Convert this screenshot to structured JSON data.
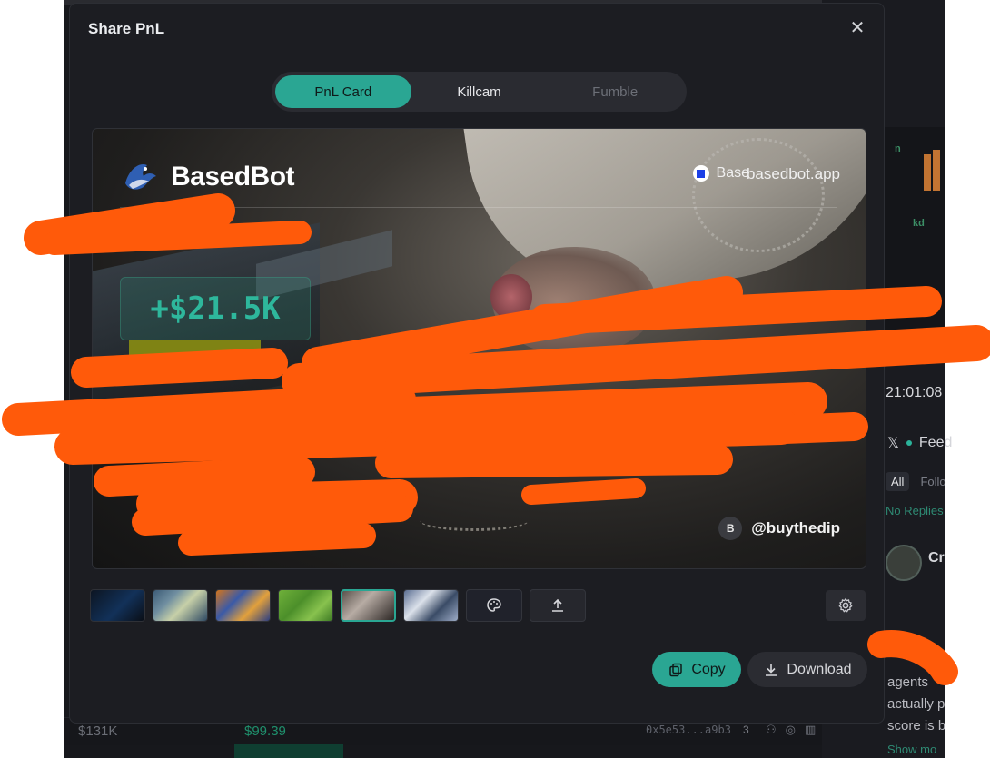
{
  "background": {
    "bottom_row": {
      "price_left": "$131K",
      "price_green": "$99.39",
      "address": "0x5e53...a9b3",
      "count": "3"
    },
    "right_panel": {
      "time": "21:01:08",
      "feed_label": "Feed",
      "tabs": [
        "All",
        "Follo"
      ],
      "no_replies": "No Replies",
      "user_name": "Cr",
      "post_lines": [
        "agents",
        "actually p",
        "score is b"
      ],
      "show_more": "Show mo"
    }
  },
  "modal": {
    "title": "Share PnL",
    "close_icon": "close-icon",
    "tabs": [
      {
        "label": "PnL Card",
        "state": "active"
      },
      {
        "label": "Killcam",
        "state": "normal"
      },
      {
        "label": "Fumble",
        "state": "disabled"
      }
    ],
    "card": {
      "brand": "BasedBot",
      "chain": "Base",
      "site": "basedbot.app",
      "pnl": "+$21.5K",
      "handle_initial": "B",
      "handle": "@buythedip"
    },
    "backgrounds": [
      "space",
      "city",
      "arcade",
      "pixel-field",
      "portrait",
      "skyline"
    ],
    "selected_background": "portrait",
    "tools": {
      "palette_icon": "palette-icon",
      "upload_icon": "upload-icon",
      "settings_icon": "gear-icon"
    },
    "actions": {
      "copy": "Copy",
      "download": "Download"
    }
  },
  "colors": {
    "accent": "#2aa693",
    "modal_bg": "#1c1d22",
    "redaction": "#ff5a0a"
  }
}
